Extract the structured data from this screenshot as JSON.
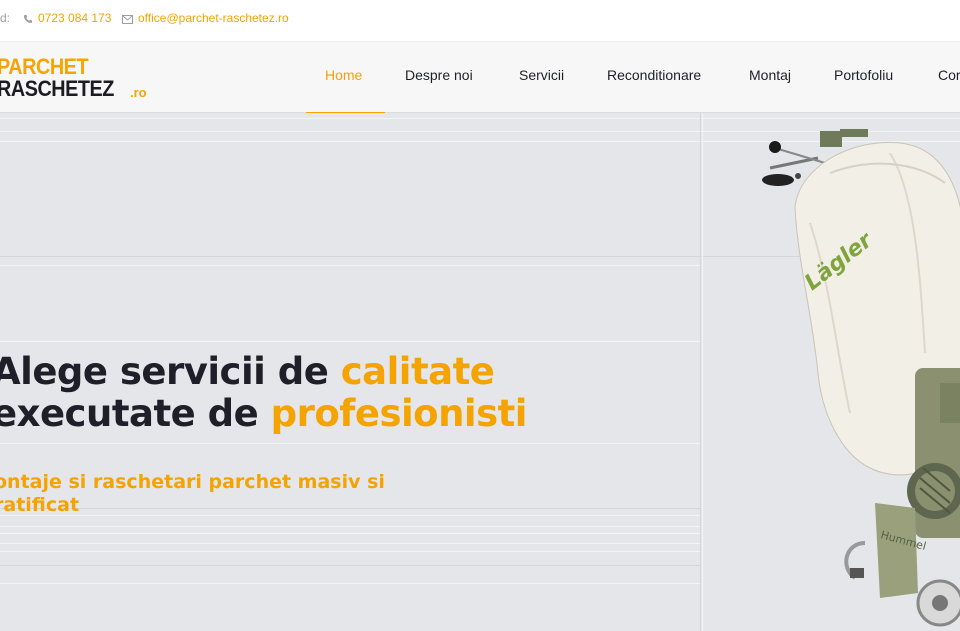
{
  "topbar": {
    "label_fragment": "d:",
    "phone": "0723 084 173",
    "email": "office@parchet-raschetez.ro"
  },
  "logo": {
    "line1": "PARCHET",
    "line2": "RASCHETEZ",
    "suffix": ".ro"
  },
  "nav": {
    "items": [
      {
        "label": "Home",
        "active": true
      },
      {
        "label": "Despre noi"
      },
      {
        "label": "Servicii"
      },
      {
        "label": "Reconditionare"
      },
      {
        "label": "Montaj"
      },
      {
        "label": "Portofoliu"
      },
      {
        "label": "Cor"
      }
    ]
  },
  "hero": {
    "line1_plain": "Alege servicii de ",
    "line1_accent": "calitate",
    "line2_plain": "executate de ",
    "line2_accent": "profesionisti",
    "subtitle": "ontaje si raschetari parchet masiv si ratificat",
    "machine_brand": "Lägler",
    "machine_model": "Hummel"
  },
  "colors": {
    "accent": "#f4a300",
    "text_dark": "#1f1f2a",
    "hero_bg": "#e4e6e9"
  }
}
